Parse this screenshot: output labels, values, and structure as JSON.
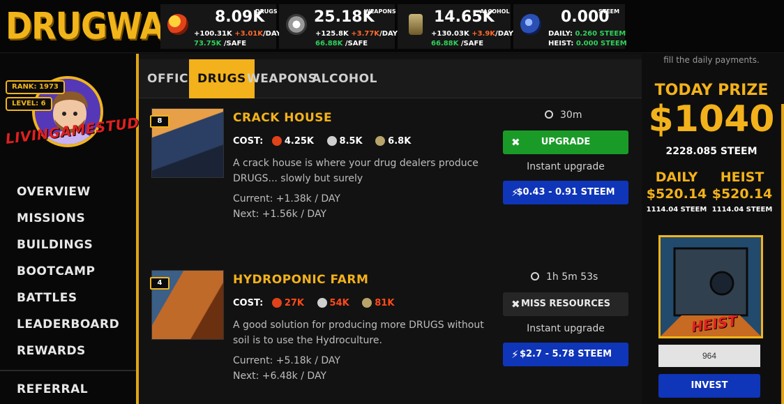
{
  "app": {
    "logo": "DRUGWARS"
  },
  "resources": [
    {
      "icon": "drugs-icon",
      "color": "#e0421a",
      "amount": "8.09K",
      "tag": "DRUGS",
      "rate": "+100.31K",
      "bonus": "+3.01K",
      "per_day": "/DAY",
      "safe": "73.75K",
      "safe_label": "/SAFE"
    },
    {
      "icon": "weapons-icon",
      "color": "#d9d9d9",
      "amount": "25.18K",
      "tag": "WEAPONS",
      "rate": "+125.8K",
      "bonus": "+3.77K",
      "per_day": "/DAY",
      "safe": "66.88K",
      "safe_label": "/SAFE"
    },
    {
      "icon": "alcohol-icon",
      "color": "#b8a46a",
      "amount": "14.65K",
      "tag": "ALCOHOL",
      "rate": "+130.03K",
      "bonus": "+3.9K",
      "per_day": "/DAY",
      "safe": "66.88K",
      "safe_label": "/SAFE"
    },
    {
      "icon": "steem-icon",
      "color": "#2a4fb5",
      "amount": "0.000",
      "tag": "STEEM",
      "daily_label": "DAILY:",
      "daily_value": "0.260 STEEM",
      "heist_label": "HEIST:",
      "heist_value": "0.000 STEEM"
    }
  ],
  "profile": {
    "rank": "RANK: 1973",
    "level": "LEVEL: 6",
    "username": "LIVINGAMESTUDIOS"
  },
  "nav": [
    "OVERVIEW",
    "MISSIONS",
    "BUILDINGS",
    "BOOTCAMP",
    "BATTLES",
    "LEADERBOARD",
    "REWARDS",
    "REFERRAL"
  ],
  "tabs": [
    {
      "label": "OFFICE",
      "active": false
    },
    {
      "label": "DRUGS",
      "active": true
    },
    {
      "label": "WEAPONS",
      "active": false
    },
    {
      "label": "ALCOHOL",
      "active": false
    }
  ],
  "buildings": [
    {
      "level": "8",
      "name": "CRACK HOUSE",
      "cost_label": "COST:",
      "cost": [
        {
          "icon": "drugs-icon",
          "value": "4.25K",
          "enough": true
        },
        {
          "icon": "weapons-icon",
          "value": "8.5K",
          "enough": true
        },
        {
          "icon": "alcohol-icon",
          "value": "6.8K",
          "enough": true
        }
      ],
      "description": "A crack house is where your drug dealers produce DRUGS... slowly but surely",
      "current": "Current: +1.38k / DAY",
      "next": "Next: +1.56k / DAY",
      "timer": "30m",
      "action_label": "UPGRADE",
      "action_state": "available",
      "instant_label": "Instant upgrade",
      "instant_price": "$0.43 - 0.91 STEEM"
    },
    {
      "level": "4",
      "name": "HYDROPONIC FARM",
      "cost_label": "COST:",
      "cost": [
        {
          "icon": "drugs-icon",
          "value": "27K",
          "enough": false
        },
        {
          "icon": "weapons-icon",
          "value": "54K",
          "enough": false
        },
        {
          "icon": "alcohol-icon",
          "value": "81K",
          "enough": false
        }
      ],
      "description": "A good solution for producing more DRUGS without soil is to use the Hydroculture.",
      "current": "Current: +5.18k / DAY",
      "next": "Next: +6.48k / DAY",
      "timer": "1h 5m 53s",
      "action_label": "MISS RESOURCES",
      "action_state": "disabled",
      "instant_label": "Instant upgrade",
      "instant_price": "$2.7 - 5.78 STEEM"
    }
  ],
  "prize": {
    "note": "fill the daily payments.",
    "title": "TODAY PRIZE",
    "amount": "$1040",
    "steem": "2228.085 STEEM",
    "daily_label": "DAILY",
    "daily_usd": "$520.14",
    "daily_steem": "1114.04 STEEM",
    "heist_label": "HEIST",
    "heist_usd": "$520.14",
    "heist_steem": "1114.04 STEEM",
    "heist_image_label": "HEIST",
    "input_value": "964",
    "invest_label": "INVEST"
  },
  "colors": {
    "accent": "#f3b21b",
    "green_button": "#1a9b28",
    "blue_button": "#0f35b8",
    "red_text": "#ff4a1a",
    "safe_green": "#2ed15a"
  }
}
